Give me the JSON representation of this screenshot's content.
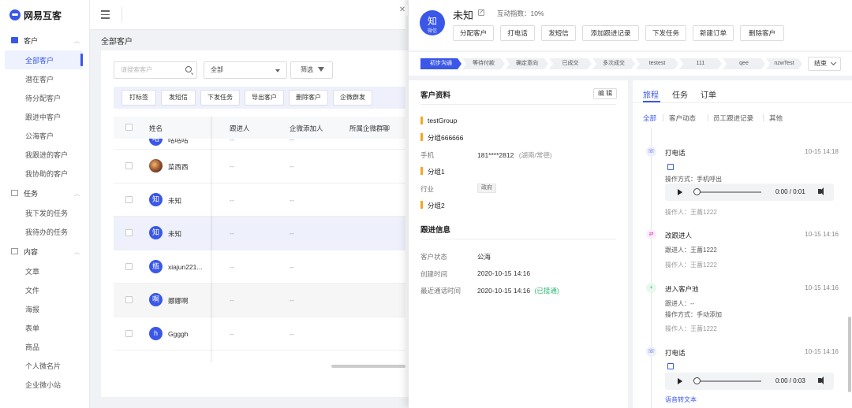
{
  "brand": {
    "name": "网易互客"
  },
  "sidebar": {
    "groups": [
      {
        "label": "客户",
        "items": [
          "全部客户",
          "潜在客户",
          "待分配客户",
          "跟进中客户",
          "公海客户",
          "我跟进的客户",
          "我协助的客户"
        ]
      },
      {
        "label": "任务",
        "items": [
          "我下发的任务",
          "我待办的任务"
        ]
      },
      {
        "label": "内容",
        "items": [
          "文章",
          "文件",
          "海报",
          "表单",
          "商品",
          "个人微名片",
          "企业微小站"
        ]
      }
    ],
    "active_item": "全部客户"
  },
  "main": {
    "page_title": "全部客户",
    "search_placeholder": "请搜索客户",
    "select_value": "全部",
    "filter_label": "筛选",
    "actions": [
      "打标签",
      "发短信",
      "下发任务",
      "导出客户",
      "删除客户",
      "企微群发"
    ],
    "table": {
      "columns": [
        "姓名",
        "跟进人",
        "企微添加人",
        "所属企微群聊"
      ],
      "rows": [
        {
          "avatar": "咕",
          "name": "咕咕咕",
          "cells": [
            "--",
            "--"
          ]
        },
        {
          "avatar": "",
          "name": "菜西西",
          "cells": [
            "--",
            "--"
          ]
        },
        {
          "avatar": "知",
          "name": "未知",
          "cells": [
            "--",
            "--"
          ]
        },
        {
          "avatar": "知",
          "name": "未知",
          "cells": [
            "--",
            "--"
          ]
        },
        {
          "avatar": "瓶",
          "name": "xiajun221...",
          "cells": [
            "--",
            "--"
          ]
        },
        {
          "avatar": "啊",
          "name": "娜娜啊",
          "cells": [
            "--",
            "--"
          ]
        },
        {
          "avatar": "h",
          "name": "Ggggh",
          "cells": [
            "--",
            "--"
          ]
        }
      ]
    }
  },
  "drawer": {
    "avatar_char": "知",
    "avatar_sub": "微信",
    "name": "未知",
    "interaction_index": "互动指数：10%",
    "header_buttons": [
      "分配客户",
      "打电话",
      "发短信",
      "添加跟进记录",
      "下发任务",
      "新建订单",
      "删除客户"
    ],
    "stages": [
      "初步沟通",
      "等待付款",
      "确定意向",
      "已成交",
      "多次成交",
      "testest",
      "111",
      "qee",
      "nzwTest"
    ],
    "end_label": "结束",
    "profile": {
      "title": "客户资料",
      "edit_label": "编 辑",
      "group1": "testGroup",
      "group2": "分组666666",
      "phone_label": "手机",
      "phone_value": "181****2812",
      "phone_region": "(湖南/常德)",
      "group3": "分组1",
      "industry_label": "行业",
      "industry_value": "政府",
      "group4": "分组2"
    },
    "follow": {
      "title": "跟进信息",
      "status_label": "客户状态",
      "status_value": "公海",
      "created_label": "创建时间",
      "created_value": "2020-10-15 14:16",
      "last_call_label": "最近通话时间",
      "last_call_value": "2020-10-15 14:16",
      "last_call_state": "(已接通)"
    },
    "right_tabs": [
      "旅程",
      "任务",
      "订单"
    ],
    "sub_tabs": [
      "全部",
      "客户动态",
      "员工跟进记录",
      "其他"
    ],
    "timeline": [
      {
        "icon": "phone-icon",
        "title": "打电话",
        "time": "10-15 14:18",
        "text": "操作方式：手机呼出",
        "audio_time": "0:00 / 0:01",
        "operator": "操作人：王薔1222"
      },
      {
        "icon": "swap-icon",
        "title": "改跟进人",
        "time": "10-15 14:16",
        "text": "跟进人：王薔1222",
        "operator": "操作人：王薔1222"
      },
      {
        "icon": "plus-icon",
        "title": "进入客户池",
        "time": "10-15 14:16",
        "text": "跟进人：--",
        "text2": "操作方式：手动添加",
        "operator": "操作人：王薔1222"
      },
      {
        "icon": "phone-icon",
        "title": "打电话",
        "time": "10-15 14:16",
        "audio_time": "0:00 / 0:03",
        "operator": "语音转文本"
      }
    ]
  },
  "colors": {
    "primary": "#3a57e8",
    "accent_bar": "#f5a623",
    "success": "#2bb673"
  }
}
